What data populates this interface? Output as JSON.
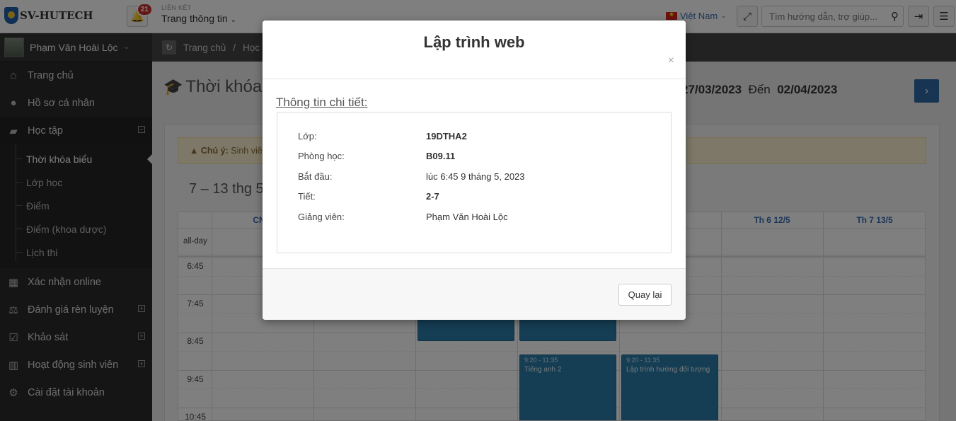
{
  "topbar": {
    "logo_text": "SV-HUTECH",
    "notifications_count": "21",
    "links_label": "LIÊN KẾT",
    "links_value": "Trang thông tin",
    "language": "Việt Nam",
    "search_placeholder": "Tìm hướng dẫn, trợ giúp..."
  },
  "sidebar": {
    "user_name": "Phạm Văn Hoài Lộc",
    "items": [
      {
        "label": "Trang chủ",
        "icon": "home-icon"
      },
      {
        "label": "Hồ sơ cá nhân",
        "icon": "user-icon"
      },
      {
        "label": "Học tập",
        "icon": "book-icon"
      },
      {
        "label": "Xác nhận online",
        "icon": "calendar-icon"
      },
      {
        "label": "Đánh giá rèn luyện",
        "icon": "balance-icon"
      },
      {
        "label": "Khảo sát",
        "icon": "checklist-icon"
      },
      {
        "label": "Hoạt động sinh viên",
        "icon": "bar-chart-icon"
      },
      {
        "label": "Cài đặt tài khoản",
        "icon": "gear-icon"
      }
    ],
    "sub_items": [
      "Thời khóa biểu",
      "Lớp học",
      "Điểm",
      "Điểm (khoa dược)",
      "Lịch thi"
    ]
  },
  "breadcrumb": {
    "home": "Trang chủ",
    "separator": "/",
    "current": "Học t"
  },
  "page": {
    "title": "Thời khóa b",
    "date_from": "27/03/2023",
    "date_to_label": "Đến",
    "date_to": "02/04/2023",
    "notice_label": "Chú ý:",
    "notice_text": "Sinh viê",
    "week_title": "7 – 13 thg 5,"
  },
  "calendar": {
    "headers": [
      "CN 0",
      "",
      "",
      "5",
      "Th 6 12/5",
      "Th 7 13/5"
    ],
    "allday_label": "all-day",
    "times": [
      "6:45",
      "7:45",
      "8:45",
      "9:45",
      "10:45"
    ],
    "events": [
      {
        "time": "9:20 - 11:35",
        "title": "Tiếng anh 2"
      },
      {
        "time": "9:20 - 11:35",
        "title": "Lập trình hướng đối tượng"
      }
    ]
  },
  "modal": {
    "title": "Lập trình web",
    "close": "×",
    "section_heading": "Thông tin chi tiết:",
    "rows": [
      {
        "label": "Lớp:",
        "value": "19DTHA2"
      },
      {
        "label": "Phòng học:",
        "value": "B09.11"
      },
      {
        "label": "Bắt đầu:",
        "value": "lúc 6:45 9 tháng 5, 2023"
      },
      {
        "label": "Tiết:",
        "value": "2-7"
      },
      {
        "label": "Giảng viên:",
        "value": "Phạm Văn Hoài Lộc"
      }
    ],
    "back_button": "Quay lại"
  }
}
